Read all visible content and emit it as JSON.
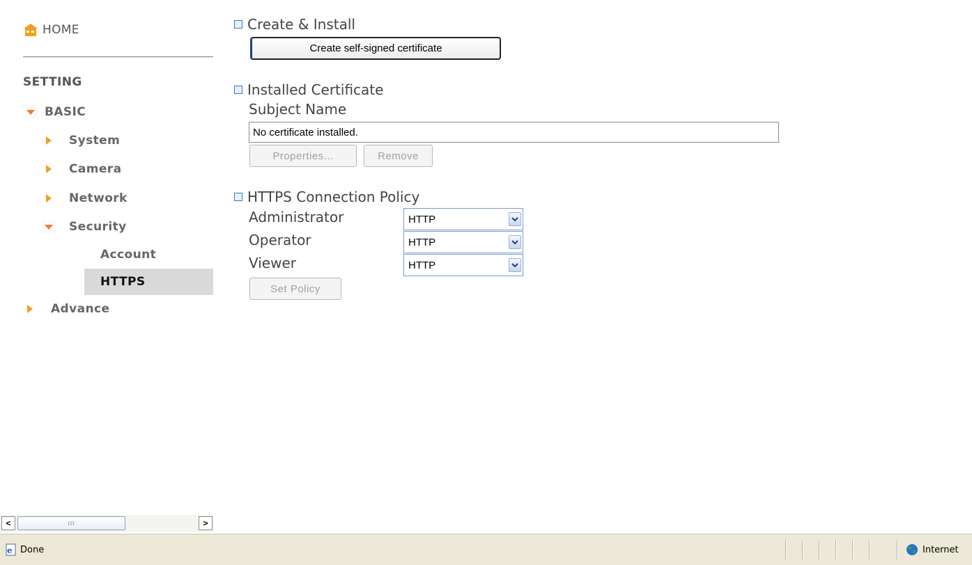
{
  "sidebar": {
    "home_label": "HOME",
    "setting_label": "SETTING",
    "basic_label": "BASIC",
    "basic_items": [
      "System",
      "Camera",
      "Network"
    ],
    "security_label": "Security",
    "security_items": [
      "Account",
      "HTTPS"
    ],
    "active_item": "HTTPS",
    "advance_label": "Advance",
    "icons": {
      "home": "home-icon",
      "expanded": "triangle-down-icon",
      "collapsed": "triangle-right-icon"
    },
    "colors": {
      "arrow": "#f0a020",
      "arrow_expanded": "#f07a30",
      "active_bg": "#d9d9d9"
    }
  },
  "main": {
    "create_section": {
      "title": "Create & Install",
      "button_label": "Create self-signed certificate"
    },
    "installed_section": {
      "title": "Installed Certificate",
      "subject_label": "Subject Name",
      "subject_value": "No certificate installed.",
      "properties_label": "Properties...",
      "remove_label": "Remove"
    },
    "policy_section": {
      "title": "HTTPS Connection Policy",
      "rows": [
        {
          "label": "Administrator",
          "value": "HTTP"
        },
        {
          "label": "Operator",
          "value": "HTTP"
        },
        {
          "label": "Viewer",
          "value": "HTTP"
        }
      ],
      "set_policy_label": "Set Policy"
    },
    "colors": {
      "section_marker": "#3a78c0",
      "text": "#444444"
    }
  },
  "scrollbar": {
    "left_arrow": "<",
    "right_arrow": ">",
    "grip": "III"
  },
  "statusbar": {
    "status_text": "Done",
    "zone_text": "Internet",
    "icons": {
      "page": "ie-page-icon",
      "zone": "globe-icon"
    }
  }
}
